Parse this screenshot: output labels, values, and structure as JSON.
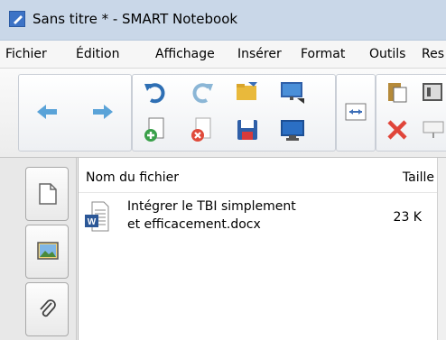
{
  "window": {
    "title": "Sans titre * - SMART Notebook",
    "app_icon": "smart-notebook-icon"
  },
  "menu": {
    "items": [
      "Fichier",
      "Édition",
      "Affichage",
      "Insérer",
      "Format",
      "Outils",
      "Res"
    ]
  },
  "toolbar": {
    "buttons": [
      {
        "name": "back-arrow-icon",
        "color": "#5aa3d8"
      },
      {
        "name": "forward-arrow-icon",
        "color": "#5aa3d8"
      },
      {
        "name": "undo-icon",
        "color": "#2e6fb4"
      },
      {
        "name": "redo-icon",
        "color": "#8bb6d6"
      },
      {
        "name": "open-folder-icon",
        "color": "#e9b93b"
      },
      {
        "name": "screen-capture-icon",
        "color": "#4a8fd8"
      },
      {
        "name": "add-page-icon",
        "color": "#3aa04a"
      },
      {
        "name": "delete-page-icon",
        "color": "#e04a3a"
      },
      {
        "name": "save-icon",
        "color": "#2f5fa8"
      },
      {
        "name": "display-screen-icon",
        "color": "#2b6fc4"
      },
      {
        "name": "fit-width-icon",
        "color": "#3d6fb8"
      },
      {
        "name": "paste-icon",
        "color": "#b58a3a"
      },
      {
        "name": "delete-icon",
        "color": "#e0453a"
      },
      {
        "name": "document-camera-icon",
        "color": "#555555"
      },
      {
        "name": "screen-shade-icon",
        "color": "#999999"
      }
    ]
  },
  "side_tabs": [
    "page-sorter-tab",
    "gallery-tab",
    "attachments-tab"
  ],
  "attachments": {
    "columns": {
      "name": "Nom du fichier",
      "size": "Taille"
    },
    "rows": [
      {
        "name_line1": "Intégrer le TBI simplement",
        "name_line2": "et efficacement.docx",
        "size": "23 K",
        "icon": "word-document-icon"
      }
    ]
  }
}
